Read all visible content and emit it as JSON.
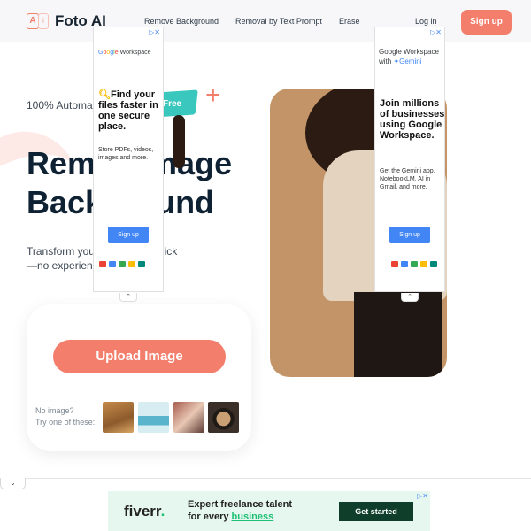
{
  "header": {
    "logo_text": "Foto AI",
    "nav": [
      "Remove Background",
      "Removal by Text Prompt",
      "Erase"
    ],
    "login": "Log in",
    "signup": "Sign up",
    "accent": "#f47e6c"
  },
  "hero": {
    "tagline": "100% Automa",
    "badge": "Free",
    "headline_line1": "Rem      mage",
    "headline_line2": "Back      und",
    "subtitle_line1": "Transform you            t one click",
    "subtitle_line2": "—no experien"
  },
  "upload": {
    "button": "Upload Image",
    "hint_line1": "No image?",
    "hint_line2": "Try one of these:"
  },
  "ad_left": {
    "brand": "Google Workspace",
    "headline": "Find your files faster in one secure place.",
    "body": "Store PDFs, videos, images and more.",
    "cta": "Sign up"
  },
  "ad_right": {
    "brand_line1": "Google Workspace",
    "brand_line2": "with",
    "gemini": "Gemini",
    "headline": "Join millions of businesses using Google Workspace.",
    "body": "Get the Gemini app, NotebookLM, AI in Gmail, and more.",
    "cta": "Sign up"
  },
  "bottom_ad": {
    "logo": "fiverr",
    "line1": "Expert freelance talent",
    "line2_prefix": "for every",
    "line2_highlight": "business",
    "cta": "Get started"
  }
}
